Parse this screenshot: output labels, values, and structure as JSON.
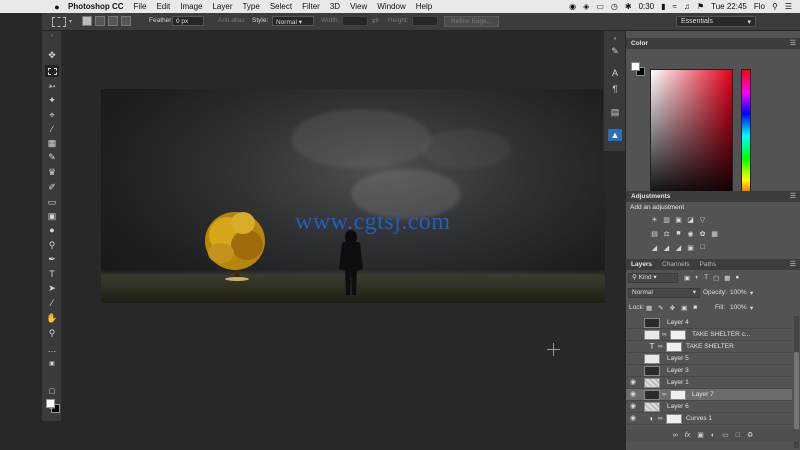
{
  "menubar": {
    "app_name": "Photoshop CC",
    "items": [
      "File",
      "Edit",
      "Image",
      "Layer",
      "Type",
      "Select",
      "Filter",
      "3D",
      "View",
      "Window",
      "Help"
    ],
    "battery_time": "0:30",
    "clock": "Tue 22:45",
    "user": "Flo"
  },
  "options": {
    "feather_label": "Feather:",
    "feather_value": "0 px",
    "antialias_label": "Anti-alias",
    "style_label": "Style:",
    "style_value": "Normal",
    "width_label": "Width:",
    "height_label": "Height:",
    "refine_edge": "Refine Edge...",
    "workspace": "Essentials"
  },
  "canvas": {
    "watermark": "www.cgtsj.com"
  },
  "color_panel": {
    "tab": "Color"
  },
  "adjustments_panel": {
    "tab": "Adjustments",
    "subtitle": "Add an adjustment"
  },
  "layers_panel": {
    "tabs": [
      "Layers",
      "Channels",
      "Paths"
    ],
    "filter_kind": "Kind",
    "blend_mode": "Normal",
    "opacity_label": "Opacity:",
    "opacity_value": "100%",
    "lock_label": "Lock:",
    "fill_label": "Fill:",
    "fill_value": "100%",
    "layers": [
      {
        "name": "Layer 4",
        "visible": false,
        "thumb": "dark"
      },
      {
        "name": "TAKE SHELTER c...",
        "visible": false,
        "thumb": "light"
      },
      {
        "name": "TAKE SHELTER",
        "visible": false,
        "thumb": "text"
      },
      {
        "name": "Layer 5",
        "visible": false,
        "thumb": "light"
      },
      {
        "name": "Layer 3",
        "visible": false,
        "thumb": "dark"
      },
      {
        "name": "Layer 1",
        "visible": true,
        "thumb": "checker"
      },
      {
        "name": "Layer 7",
        "visible": true,
        "thumb": "dark"
      },
      {
        "name": "Layer 6",
        "visible": true,
        "thumb": "checker"
      },
      {
        "name": "Curves 1",
        "visible": true,
        "thumb": "adjust"
      }
    ],
    "footer_icons": [
      "link-icon",
      "fx-icon",
      "mask-icon",
      "adjustment-icon",
      "group-icon",
      "new-layer-icon",
      "trash-icon"
    ]
  },
  "colors": {
    "accent": "#2d6fb5",
    "watermark": "#1f5fc4"
  }
}
